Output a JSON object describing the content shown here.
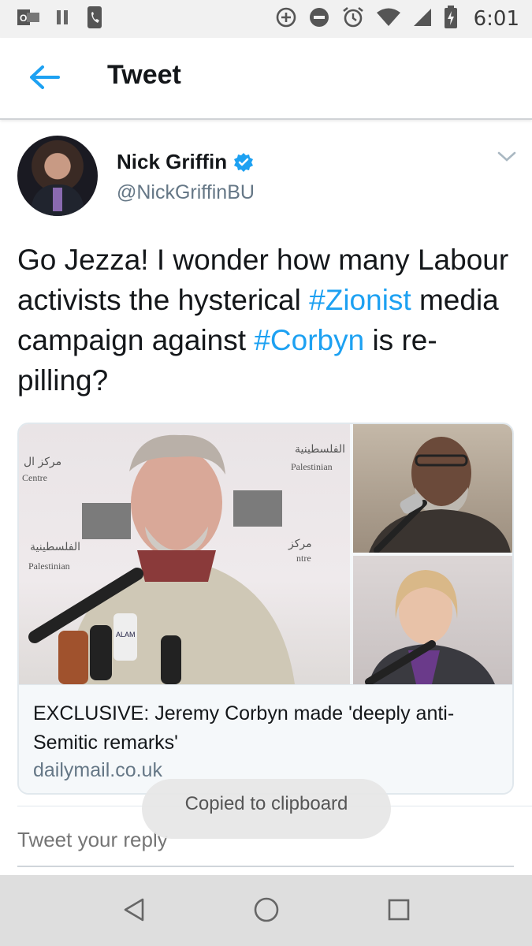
{
  "status_bar": {
    "time": "6:01",
    "left_icons": [
      "outlook-icon",
      "pause-icon",
      "phone-icon"
    ],
    "right_icons": [
      "data-saver-icon",
      "do-not-disturb-icon",
      "alarm-icon",
      "wifi-icon",
      "signal-icon",
      "battery-charging-icon"
    ]
  },
  "appbar": {
    "title": "Tweet",
    "back_icon": "arrow-left-icon"
  },
  "tweet": {
    "user": {
      "name": "Nick Griffin",
      "handle": "@NickGriffinBU",
      "verified": true
    },
    "text_parts": [
      "Go Jezza! I wonder how many Labour activists the hysterical ",
      "#Zionist",
      " media campaign against ",
      "#Corbyn",
      " is re-pilling?"
    ],
    "card": {
      "title": "EXCLUSIVE: Jeremy Corbyn made 'deeply anti-Semitic remarks'",
      "domain": "dailymail.co.uk",
      "photo_text": {
        "banner_ar_left": "مركز ال",
        "banner_centre": "Centre",
        "banner_palestinian": "Palestinian",
        "banner_ar_mid": "الفلسطينية",
        "banner_ar_right": "مركز",
        "banner_ntre": "ntre",
        "mic_label": "ALAM"
      }
    }
  },
  "reply": {
    "placeholder": "Tweet your reply"
  },
  "toast": {
    "text": "Copied to clipboard"
  },
  "colors": {
    "accent": "#1da1f2",
    "text": "#14171a",
    "muted": "#657786"
  }
}
